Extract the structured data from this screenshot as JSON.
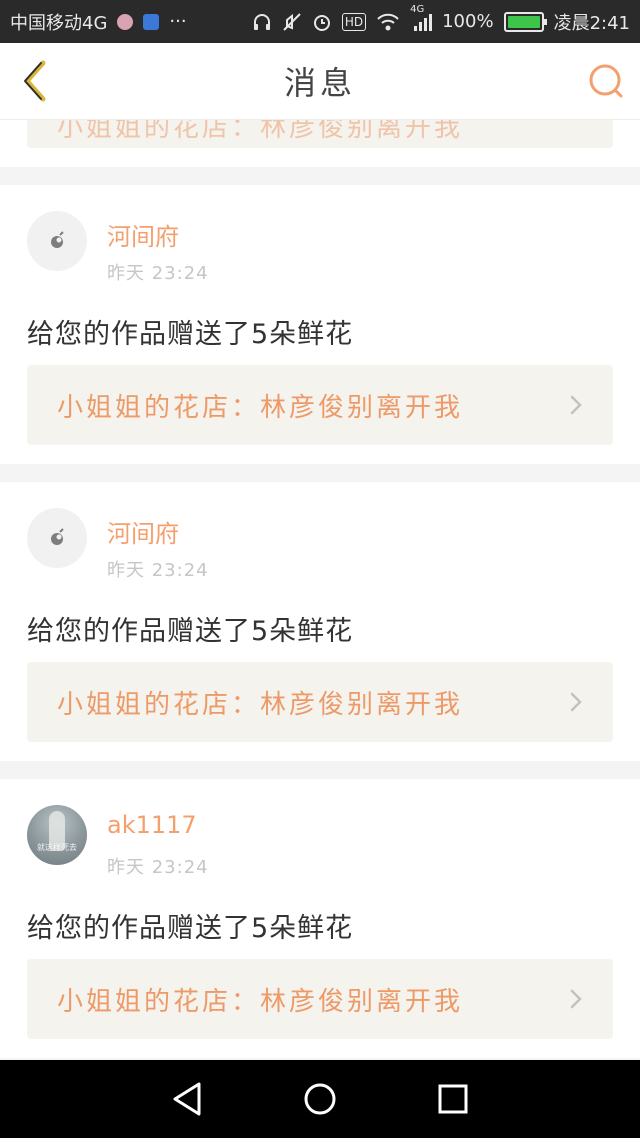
{
  "status_bar": {
    "carrier": "中国移动4G",
    "network_label": "4G",
    "battery_text": "100%",
    "battery_level": 1.0,
    "time": "凌晨2:41",
    "hd_label": "HD",
    "more_label": "···"
  },
  "header": {
    "title": "消息",
    "back_icon": "chevron-left-icon",
    "search_icon": "search-icon"
  },
  "partial_card": {
    "quote": "小姐姐的花店：林彦俊别离开我"
  },
  "messages": [
    {
      "username": "河间府",
      "time": "昨天 23:24",
      "text": "给您的作品赠送了5朵鲜花",
      "quote": "小姐姐的花店：林彦俊别离开我",
      "avatar": "default"
    },
    {
      "username": "河间府",
      "time": "昨天 23:24",
      "text": "给您的作品赠送了5朵鲜花",
      "quote": "小姐姐的花店：林彦俊别离开我",
      "avatar": "default"
    },
    {
      "username": "ak1117",
      "time": "昨天 23:24",
      "text": "给您的作品赠送了5朵鲜花",
      "quote": "小姐姐的花店：林彦俊别离开我",
      "avatar": "photo",
      "avatar_caption": "就这样死去"
    }
  ],
  "colors": {
    "accent": "#f4a06e",
    "quote_text": "#ee9a68",
    "quote_bg": "#f4f3ee",
    "status_bg": "#2a2a2a"
  }
}
